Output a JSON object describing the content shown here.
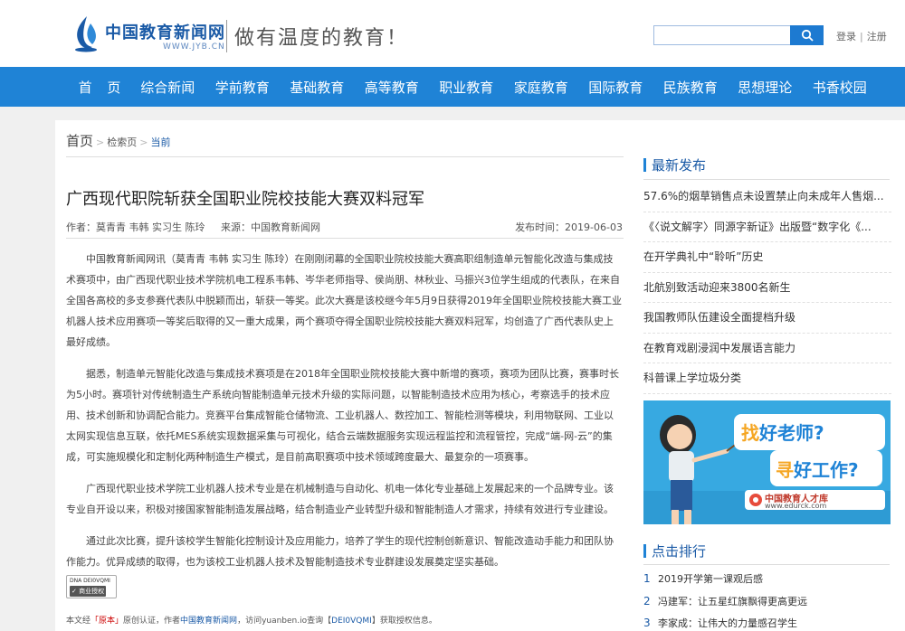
{
  "header": {
    "logo_cn": "中国教育新闻网",
    "logo_en": "WWW.JYB.CN",
    "slogan": "做有温度的教育！",
    "search_placeholder": "",
    "login": "登录",
    "register": "注册",
    "separator": "|"
  },
  "nav": {
    "items": [
      "首 页",
      "综合新闻",
      "学前教育",
      "基础教育",
      "高等教育",
      "职业教育",
      "家庭教育",
      "国际教育",
      "民族教育",
      "思想理论",
      "书香校园"
    ]
  },
  "breadcrumb": {
    "home": "首页",
    "level2": "检索页",
    "current": "当前",
    "gt": ">"
  },
  "article": {
    "title": "广西现代职院斩获全国职业院校技能大赛双料冠军",
    "authors": "作者：莫青青 韦韩 实习生 陈玲",
    "source": "来源：中国教育新闻网",
    "pubtime": "发布时间：2019-06-03",
    "paragraphs": [
      "中国教育新闻网讯（莫青青 韦韩 实习生 陈玲）在刚刚闭幕的全国职业院校技能大赛高职组制造单元智能化改造与集成技术赛项中，由广西现代职业技术学院机电工程系韦韩、岑华老师指导、侯尚朋、林秋业、马振兴3位学生组成的代表队，在来自全国各高校的多支参赛代表队中脱颖而出，斩获一等奖。此次大赛是该校继今年5月9日获得2019年全国职业院校技能大赛工业机器人技术应用赛项一等奖后取得的又一重大成果，两个赛项夺得全国职业院校技能大赛双料冠军，均创造了广西代表队史上最好成绩。",
      "据悉，制造单元智能化改造与集成技术赛项是在2018年全国职业院校技能大赛中新增的赛项，赛项为团队比赛，赛事时长为5小时。赛项针对传统制造生产系统向智能制造单元技术升级的实际问题，以智能制造技术应用为核心，考察选手的技术应用、技术创新和协调配合能力。竞赛平台集成智能仓储物流、工业机器人、数控加工、智能检测等模块，利用物联网、工业以太网实现信息互联，依托MES系统实现数据采集与可视化，结合云端数据服务实现远程监控和流程管控，完成“端-网-云”的集成，可实施规模化和定制化两种制造生产模式，是目前高职赛项中技术领域跨度最大、最复杂的一项赛事。",
      "广西现代职业技术学院工业机器人技术专业是在机械制造与自动化、机电一体化专业基础上发展起来的一个品牌专业。该专业自开设以来，积极对接国家智能制造发展战略，结合制造业产业转型升级和智能制造人才需求，持续有效进行专业建设。",
      "通过此次比赛，提升该校学生智能化控制设计及应用能力，培养了学生的现代控制创新意识、智能改造动手能力和团队协作能力。优异成绩的取得，也为该校工业机器人技术及智能制造技术专业群建设发展奠定坚实基础。"
    ],
    "dna_code": "DNA DEI0VQMI",
    "dna_badge": "✓ 商业授权",
    "footer_pre": "本文经",
    "footer_origin": "「原本」",
    "footer_mid": "原创认证，作者",
    "footer_author": "中国教育新闻网",
    "footer_post": "，访问yuanben.io查询【",
    "footer_code": "DEI0VQMI",
    "footer_end": "】获取授权信息。"
  },
  "sidebar": {
    "latest_title": "最新发布",
    "latest": [
      "57.6%的烟草销售点未设置禁止向未成年人售烟...",
      "《〈说文解字〉同源字新证》出版暨“数字化《...",
      "在开学典礼中“聆听”历史",
      "北航别致活动迎来3800名新生",
      "我国教师队伍建设全面提档升级",
      "在教育戏剧浸润中发展语言能力",
      "科普课上学垃圾分类"
    ],
    "ad": {
      "line1_a": "找",
      "line1_b": "好老师?",
      "line2_a": "寻",
      "line2_b": "好工作?",
      "brand": "中国教育人才库",
      "url": "www.edurck.com"
    },
    "rank_title": "点击排行",
    "rank": [
      {
        "n": "1",
        "t": "2019开学第一课观后感"
      },
      {
        "n": "2",
        "t": "冯建军：让五星红旗飘得更高更远"
      },
      {
        "n": "3",
        "t": "李家成：让伟大的力量感召学生"
      }
    ]
  },
  "colors": {
    "brand_blue": "#1f83d6",
    "link_blue": "#1a5aa6",
    "ad_bg": "#37a9e1",
    "ad_accent": "#f5a623"
  }
}
